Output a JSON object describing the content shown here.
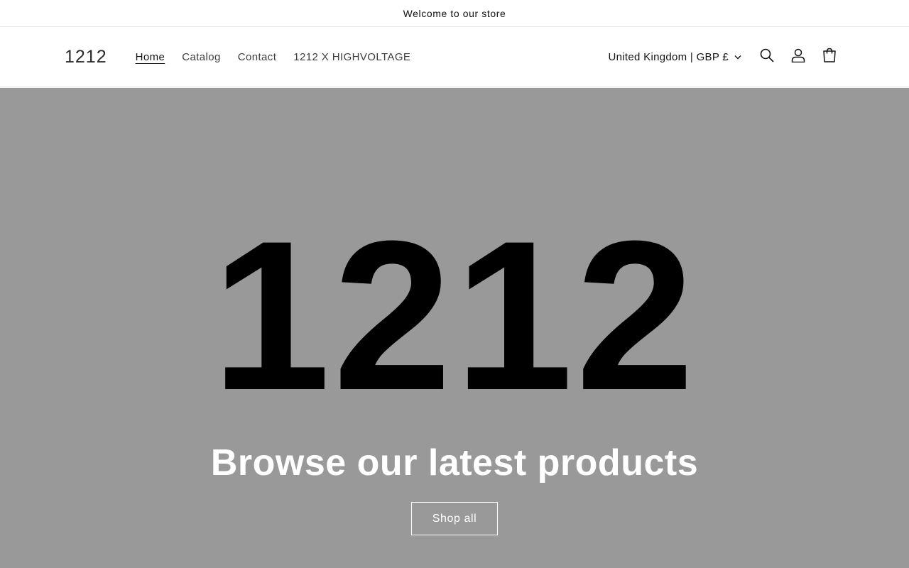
{
  "announcement": {
    "text": "Welcome to our store"
  },
  "header": {
    "logo": "1212",
    "nav": [
      {
        "label": "Home",
        "active": true
      },
      {
        "label": "Catalog",
        "active": false
      },
      {
        "label": "Contact",
        "active": false
      },
      {
        "label": "1212 X HIGHVOLTAGE",
        "active": false
      }
    ],
    "country_selector": "United Kingdom | GBP £",
    "icons": [
      "search-icon",
      "account-icon",
      "cart-icon"
    ]
  },
  "hero": {
    "logo_text": "1212",
    "heading": "Browse our latest products",
    "button_label": "Shop all",
    "background_color": "#999999"
  }
}
